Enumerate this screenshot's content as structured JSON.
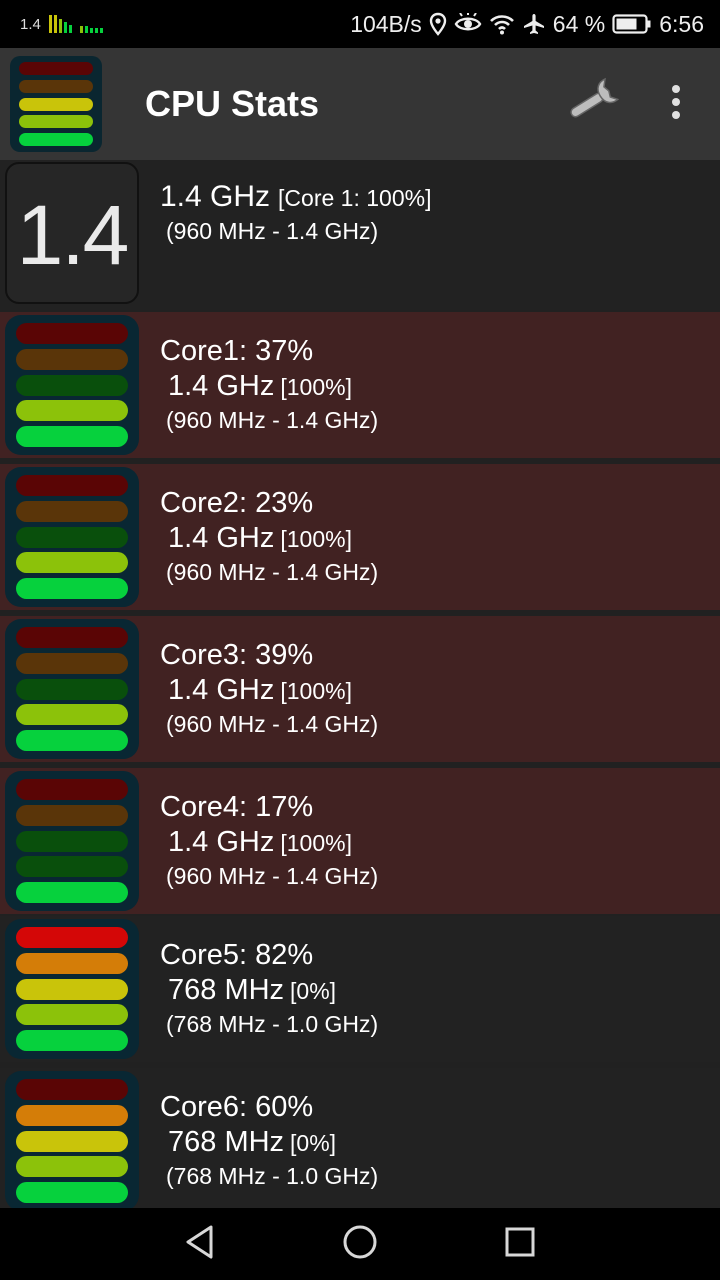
{
  "status_bar": {
    "mini_label": "1.4",
    "net_speed": "104B/s",
    "battery": "64 %",
    "time": "6:56",
    "icons": [
      "equalizer-icon",
      "location-icon",
      "eye-icon",
      "wifi-icon",
      "airplane-icon",
      "battery-icon"
    ]
  },
  "app_bar": {
    "title": "CPU Stats",
    "actions": [
      "wrench-icon",
      "more-vert-icon"
    ]
  },
  "summary": {
    "big_value": "1.4",
    "freq": "1.4 GHz",
    "core_detail": "[Core 1: 100%]",
    "range": "(960 MHz - 1.4 GHz)"
  },
  "cores": [
    {
      "name": "Core1: 37%",
      "freq": "1.4 GHz",
      "freq_pct": "[100%]",
      "range": "(960 MHz - 1.4 GHz)",
      "state": "hot"
    },
    {
      "name": "Core2: 23%",
      "freq": "1.4 GHz",
      "freq_pct": "[100%]",
      "range": "(960 MHz - 1.4 GHz)",
      "state": "hot"
    },
    {
      "name": "Core3: 39%",
      "freq": "1.4 GHz",
      "freq_pct": "[100%]",
      "range": "(960 MHz - 1.4 GHz)",
      "state": "hot"
    },
    {
      "name": "Core4: 17%",
      "freq": "1.4 GHz",
      "freq_pct": "[100%]",
      "range": "(960 MHz - 1.4 GHz)",
      "state": "hot"
    },
    {
      "name": "Core5: 82%",
      "freq": "768 MHz",
      "freq_pct": "[0%]",
      "range": "(768 MHz - 1.0 GHz)",
      "state": "cool"
    },
    {
      "name": "Core6: 60%",
      "freq": "768 MHz",
      "freq_pct": "[0%]",
      "range": "(768 MHz - 1.0 GHz)",
      "state": "cool"
    }
  ],
  "meter_levels": {
    "app_logo": [
      "bright-green",
      "lime",
      "yellow",
      "dim-orange",
      "dim-red"
    ],
    "core1": [
      "bright-green",
      "lime",
      "dim-green",
      "dim-orange",
      "dim-red"
    ],
    "core2": [
      "bright-green",
      "lime",
      "dim-green",
      "dim-orange",
      "dim-red"
    ],
    "core3": [
      "bright-green",
      "lime",
      "dim-green",
      "dim-orange",
      "dim-red"
    ],
    "core4": [
      "bright-green",
      "dim-green",
      "dim-green",
      "dim-orange",
      "dim-red"
    ],
    "core5": [
      "bright-green",
      "lime",
      "yellow",
      "orange",
      "red"
    ],
    "core6": [
      "bright-green",
      "lime",
      "yellow",
      "orange",
      "dim-red"
    ]
  },
  "colors": {
    "bright-green": "#06d13d",
    "lime": "#8cc20a",
    "dim-green": "#094f0c",
    "yellow": "#c9c40a",
    "orange": "#d47d08",
    "dim-orange": "#5a3509",
    "red": "#d40707",
    "dim-red": "#5a0505",
    "hot_row_bg": "#412222",
    "cool_row_bg": "#222222"
  },
  "nav_bar": {
    "buttons": [
      "back-icon",
      "home-icon",
      "recents-icon"
    ]
  }
}
